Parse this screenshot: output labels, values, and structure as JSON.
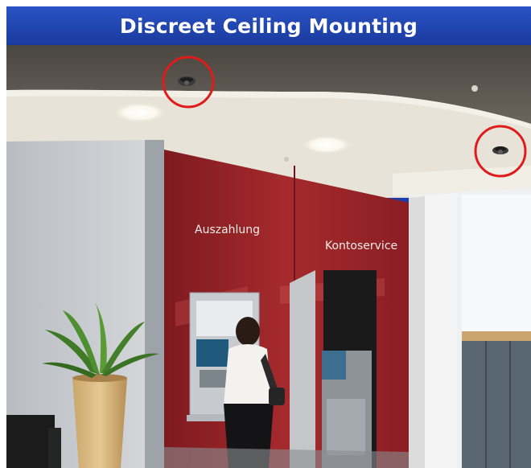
{
  "banner": {
    "title": "Discreet Ceiling Mounting",
    "background_color": "#1e3fa8",
    "text_color": "#ffffff"
  },
  "photo": {
    "wall_signs": [
      "Auszahlung",
      "Kontoservice"
    ],
    "highlight_color": "#e01b1b",
    "highlights": [
      "ceiling-camera-left",
      "ceiling-camera-right"
    ]
  }
}
